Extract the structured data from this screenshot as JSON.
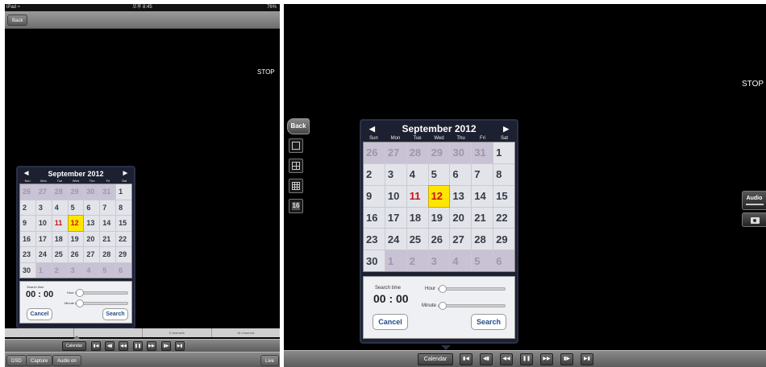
{
  "left": {
    "status": {
      "device": "iPad ≈",
      "time": "오후 8:45",
      "battery": "76%"
    },
    "back_label": "Back",
    "stop_label": "STOP",
    "calendar": {
      "title": "September 2012",
      "dow": [
        "Sun",
        "Mon",
        "Tue",
        "Wed",
        "Thu",
        "Fri",
        "Sat"
      ],
      "search_time_label": "Search time",
      "time_value": "00 : 00",
      "hour_label": "Hour",
      "minute_label": "Minute",
      "cancel_label": "Cancel",
      "search_label": "Search"
    },
    "channel_tabs": [
      "",
      "",
      "9 channels",
      "16 channels"
    ],
    "calendar_btn": "Calendar",
    "bottom": {
      "dsd": "DSD",
      "capture": "Capture",
      "audio": "Audio on",
      "live": "Live"
    }
  },
  "right": {
    "back_label": "Back",
    "stop_label": "STOP",
    "calendar": {
      "title": "September 2012",
      "dow": [
        "Sun",
        "Mon",
        "Tue",
        "Wed",
        "Thu",
        "Fri",
        "Sat"
      ],
      "search_time_label": "Search time",
      "time_value": "00 : 00",
      "hour_label": "Hour",
      "minute_label": "Minute",
      "cancel_label": "Cancel",
      "search_label": "Search"
    },
    "side_16_label": "16",
    "audio_label": "Audio",
    "calendar_btn": "Calendar"
  },
  "weeks": [
    [
      "26",
      "27",
      "28",
      "29",
      "30",
      "31",
      "1"
    ],
    [
      "2",
      "3",
      "4",
      "5",
      "6",
      "7",
      "8"
    ],
    [
      "9",
      "10",
      "11",
      "12",
      "13",
      "14",
      "15"
    ],
    [
      "16",
      "17",
      "18",
      "19",
      "20",
      "21",
      "22"
    ],
    [
      "23",
      "24",
      "25",
      "26",
      "27",
      "28",
      "29"
    ],
    [
      "30",
      "1",
      "2",
      "3",
      "4",
      "5",
      "6"
    ]
  ],
  "playback_icons": [
    "skip-start-icon",
    "step-back-icon",
    "rewind-icon",
    "pause-icon",
    "fast-forward-icon",
    "step-forward-icon",
    "skip-end-icon"
  ],
  "colors": {
    "selected": "#ffe600",
    "holiday": "#cc1111",
    "panel": "#1c2030"
  }
}
